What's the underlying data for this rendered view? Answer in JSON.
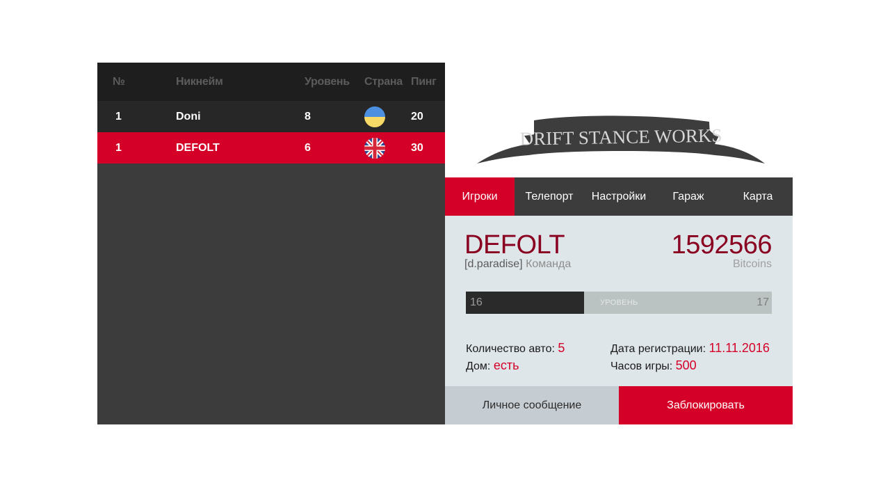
{
  "players": {
    "columns": [
      "№",
      "Никнейм",
      "Уровень",
      "Страна",
      "Пинг"
    ],
    "rows": [
      {
        "num": "1",
        "nick": "Doni",
        "level": "8",
        "country": "ukraine-flag-icon",
        "ping": "20"
      },
      {
        "num": "1",
        "nick": "DEFOLT",
        "level": "6",
        "country": "uk-flag-icon",
        "ping": "30"
      }
    ]
  },
  "logo": {
    "text": "DRIFT STANCE WORKS"
  },
  "tabs": [
    "Игроки",
    "Телепорт",
    "Настройки",
    "Гараж",
    "Карта"
  ],
  "profile": {
    "name": "DEFOLT",
    "team_tag": "[d.paradise]",
    "team_label": "Команда",
    "money": "1592566",
    "currency": "Bitcoins",
    "level_current": "16",
    "level_next": "17",
    "level_label": "УРОВЕНЬ",
    "level_progress": 0.386,
    "stats": {
      "cars_label": "Количество авто:",
      "cars_value": "5",
      "house_label": "Дом:",
      "house_value": "есть",
      "reg_label": "Дата регистрации:",
      "reg_value": "11.11.2016",
      "hours_label": "Часов игры:",
      "hours_value": "500"
    }
  },
  "actions": {
    "message": "Личное сообщение",
    "block": "Заблокировать"
  },
  "colors": {
    "accent": "#d50027",
    "name": "#8a0020",
    "panel_dark": "#3c3c3c",
    "header_dark": "#1e1e1e",
    "info_bg": "#dfe6ea"
  }
}
